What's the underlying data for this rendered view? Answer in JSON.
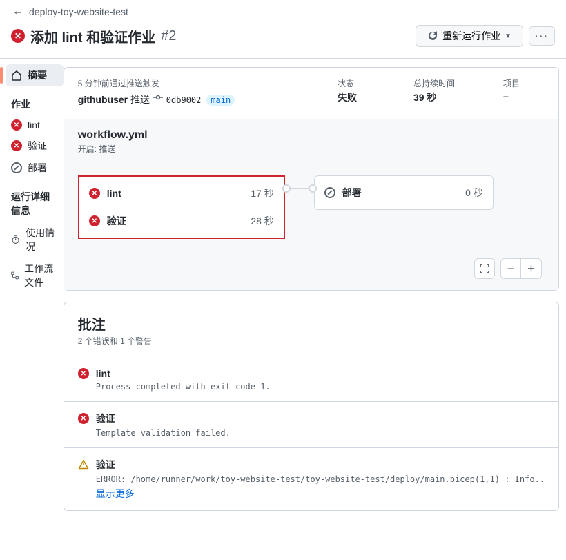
{
  "back_link": "deploy-toy-website-test",
  "title": "添加 lint 和验证作业",
  "run_number": "#2",
  "rerun_button": "重新运行作业",
  "sidebar": {
    "summary_label": "摘要",
    "jobs_heading": "作业",
    "details_heading": "运行详细信息",
    "jobs": [
      {
        "status": "fail",
        "label": "lint"
      },
      {
        "status": "fail",
        "label": "验证"
      },
      {
        "status": "skip",
        "label": "部署"
      }
    ],
    "details": [
      {
        "icon": "meter",
        "label": "使用情况"
      },
      {
        "icon": "workflow",
        "label": "工作流文件"
      }
    ]
  },
  "summary": {
    "trigger_label": "5 分钟前通过推送触发",
    "user": "githubuser",
    "user_action": "推送",
    "commit_sha": "0db9002",
    "branch": "main",
    "status_label": "状态",
    "status_value": "失败",
    "duration_label": "总持续时间",
    "duration_value": "39 秒",
    "artifacts_label": "项目",
    "artifacts_value": "–"
  },
  "workflow": {
    "filename": "workflow.yml",
    "on_label": "开启: 推送",
    "graph_jobs_left": [
      {
        "status": "fail",
        "name": "lint",
        "duration": "17 秒"
      },
      {
        "status": "fail",
        "name": "验证",
        "duration": "28 秒"
      }
    ],
    "graph_jobs_right": [
      {
        "status": "skip",
        "name": "部署",
        "duration": "0 秒"
      }
    ]
  },
  "annotations": {
    "title": "批注",
    "subtitle": "2 个错误和 1 个警告",
    "items": [
      {
        "type": "error",
        "title": "lint",
        "message": "Process completed with exit code 1."
      },
      {
        "type": "error",
        "title": "验证",
        "message": "Template validation failed."
      },
      {
        "type": "warning",
        "title": "验证",
        "message": "ERROR: /home/runner/work/toy-website-test/toy-website-test/deploy/main.bicep(1,1) : Info..",
        "show_more": "显示更多"
      }
    ]
  }
}
